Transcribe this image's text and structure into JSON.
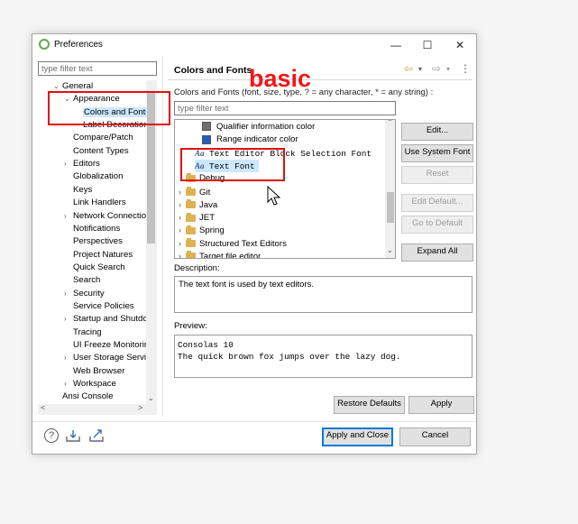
{
  "window": {
    "title": "Preferences",
    "controls": [
      "—",
      "☐",
      "✕"
    ]
  },
  "left": {
    "filter_placeholder": "type filter text",
    "tree": [
      {
        "label": "General",
        "arrow": "v"
      },
      {
        "label": "Appearance",
        "arrow": "v"
      },
      {
        "label": "Colors and Fonts",
        "selected": true
      },
      {
        "label": "Label Decorations"
      },
      {
        "label": "Compare/Patch"
      },
      {
        "label": "Content Types"
      },
      {
        "label": "Editors",
        "arrow": ">"
      },
      {
        "label": "Globalization"
      },
      {
        "label": "Keys"
      },
      {
        "label": "Link Handlers"
      },
      {
        "label": "Network Connection",
        "arrow": ">"
      },
      {
        "label": "Notifications"
      },
      {
        "label": "Perspectives"
      },
      {
        "label": "Project Natures"
      },
      {
        "label": "Quick Search"
      },
      {
        "label": "Search"
      },
      {
        "label": "Security",
        "arrow": ">"
      },
      {
        "label": "Service Policies"
      },
      {
        "label": "Startup and Shutdow",
        "arrow": ">"
      },
      {
        "label": "Tracing"
      },
      {
        "label": "UI Freeze Monitoring"
      },
      {
        "label": "User Storage Service",
        "arrow": ">"
      },
      {
        "label": "Web Browser"
      },
      {
        "label": "Workspace",
        "arrow": ">"
      },
      {
        "label": "Ansi Console"
      }
    ],
    "hscroll_left": "<",
    "hscroll_right": ">"
  },
  "right": {
    "title": "Colors and Fonts",
    "nav": {
      "back": "⇦",
      "back_menu": "▾",
      "forward": "⇨",
      "forward_menu": "▾",
      "menu": "⋮"
    },
    "description_line": "Colors and Fonts (font, size, type, ? = any character, * = any string) :",
    "filter_placeholder": "type filter text",
    "list": [
      {
        "kind": "color",
        "label": "Qualifier information color",
        "swatch": "#707070"
      },
      {
        "kind": "color",
        "label": "Range indicator color",
        "swatch": "#1e5fbf"
      },
      {
        "kind": "font",
        "label": "Text Editor Block Selection Font",
        "icon": "Aa"
      },
      {
        "kind": "font",
        "label": "Text Font",
        "icon": "Aa",
        "selected": true
      },
      {
        "kind": "folder",
        "label": "Debug"
      },
      {
        "kind": "folder",
        "label": "Git",
        "arrow": ">"
      },
      {
        "kind": "folder",
        "label": "Java",
        "arrow": ">"
      },
      {
        "kind": "folder",
        "label": "JET",
        "arrow": ">"
      },
      {
        "kind": "folder",
        "label": "Spring",
        "arrow": ">"
      },
      {
        "kind": "folder",
        "label": "Structured Text Editors",
        "arrow": ">"
      },
      {
        "kind": "folder",
        "label": "Target file editor",
        "arrow": ">"
      }
    ],
    "buttons": {
      "edit": "Edit...",
      "use_system_font": "Use System Font",
      "reset": "Reset",
      "edit_default": "Edit Default...",
      "go_to_default": "Go to Default",
      "expand_all": "Expand All"
    },
    "description_label": "Description:",
    "description_text": "The text font is used by text editors.",
    "preview_label": "Preview:",
    "preview_lines": [
      "Consolas 10",
      "The quick brown fox jumps over the lazy dog."
    ],
    "restore_defaults": "Restore Defaults",
    "apply": "Apply"
  },
  "footer": {
    "help": "?",
    "apply_and_close": "Apply and Close",
    "cancel": "Cancel"
  },
  "annotation": {
    "text": "basic",
    "color": "#f01818"
  }
}
